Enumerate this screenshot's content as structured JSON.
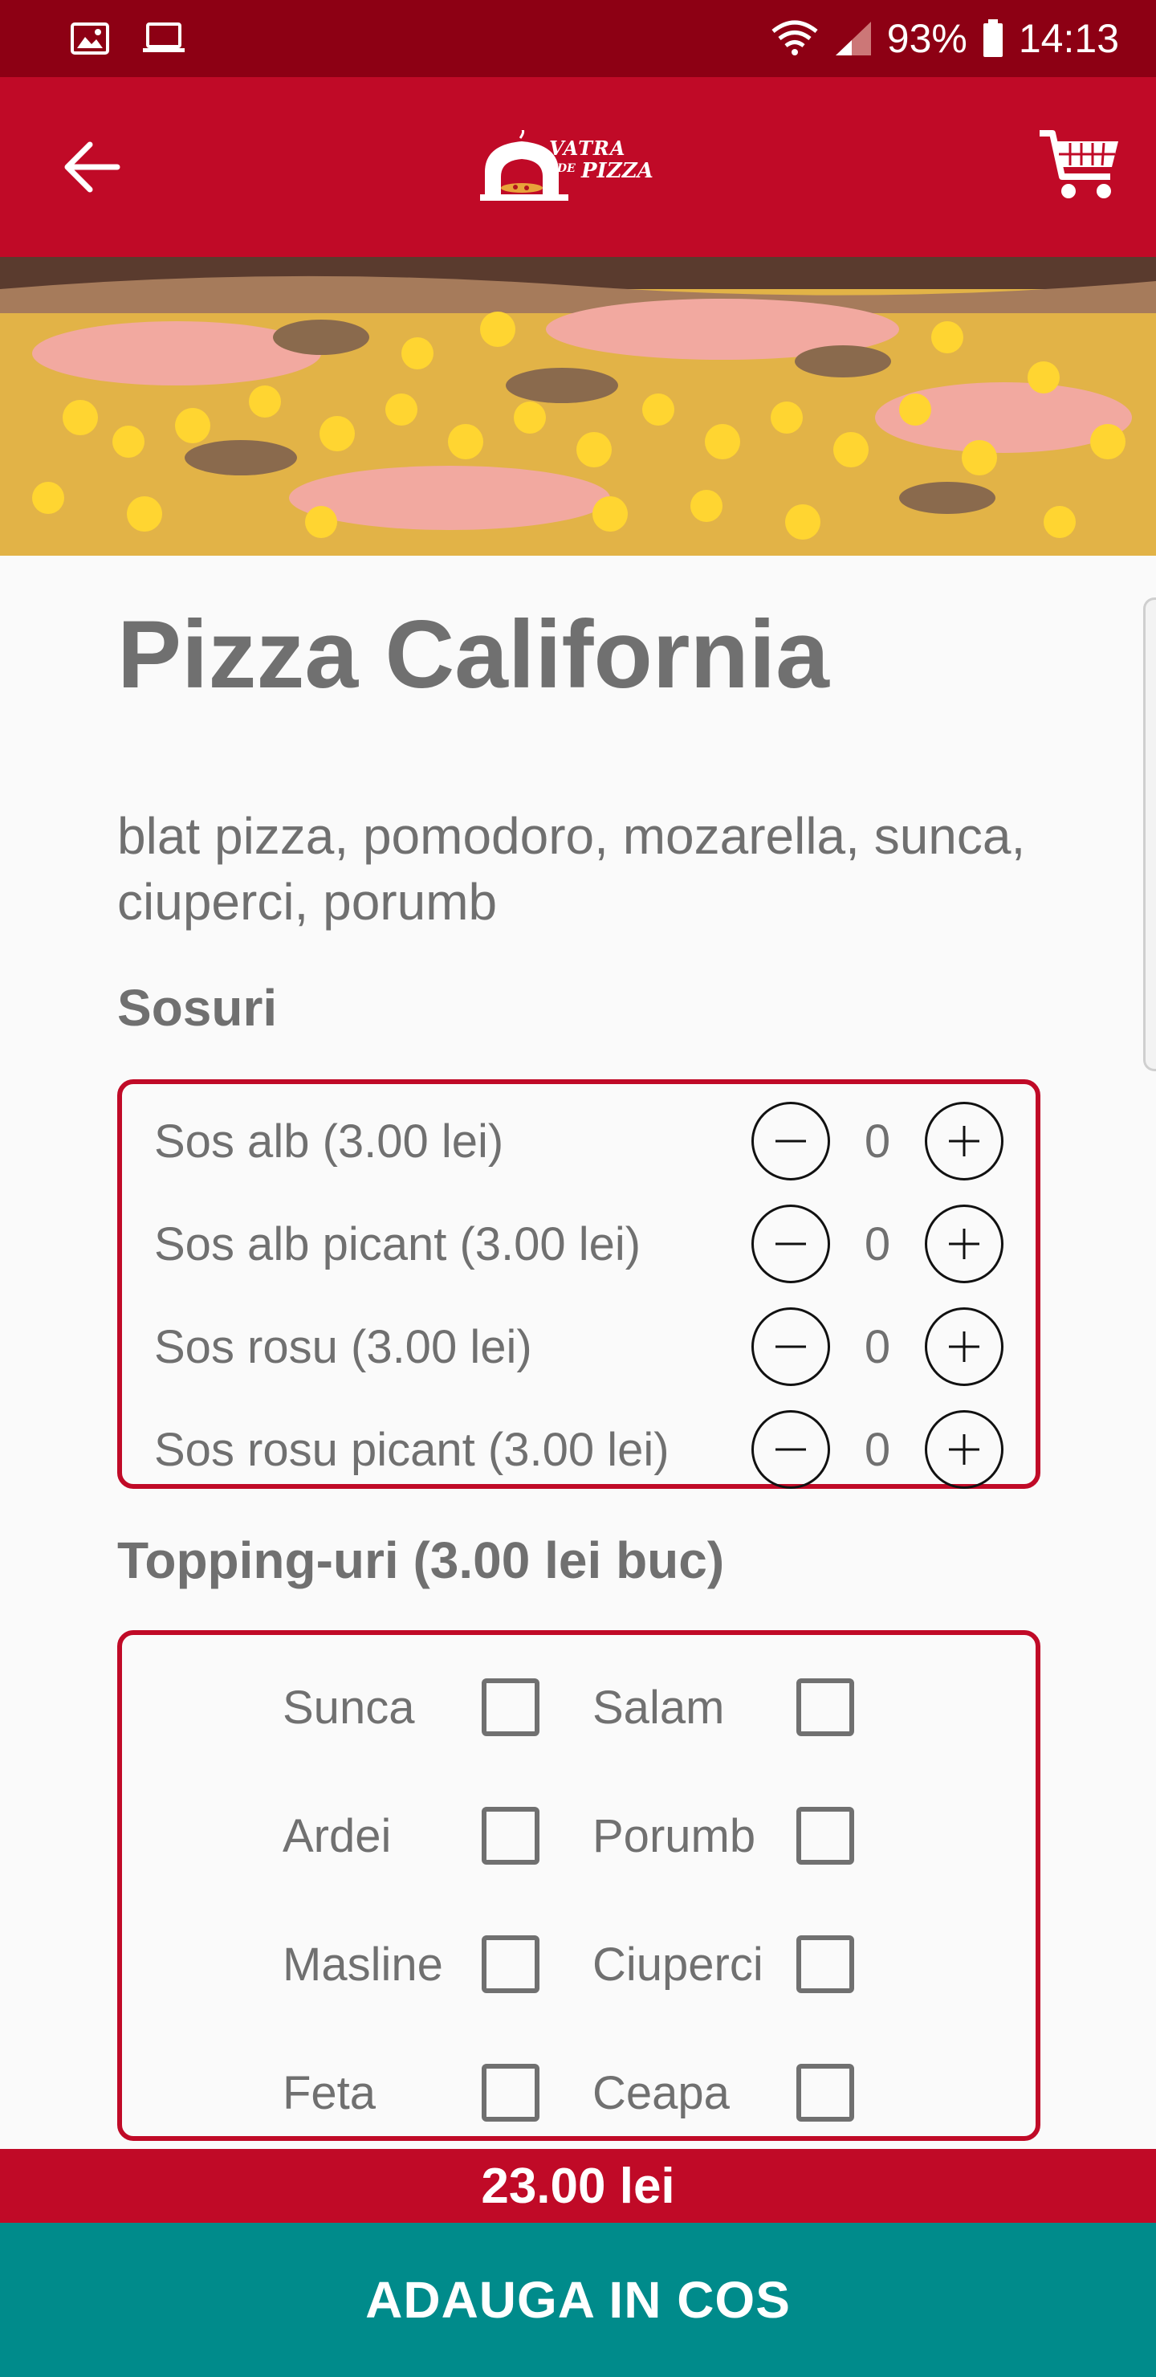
{
  "status_bar": {
    "battery": "93%",
    "time": "14:13"
  },
  "app_bar": {
    "logo_line1": "VATRA",
    "logo_line2": "DE",
    "logo_line3": "PIZZA"
  },
  "product": {
    "title": "Pizza California",
    "description": "blat pizza, pomodoro, mozarella, sunca, ciuperci, porumb"
  },
  "sauces": {
    "heading": "Sosuri",
    "items": [
      {
        "label": "Sos alb (3.00 lei)",
        "qty": "0"
      },
      {
        "label": "Sos alb picant (3.00 lei)",
        "qty": "0"
      },
      {
        "label": "Sos rosu (3.00 lei)",
        "qty": "0"
      },
      {
        "label": "Sos rosu picant (3.00 lei)",
        "qty": "0"
      }
    ]
  },
  "toppings": {
    "heading": "Topping-uri (3.00 lei buc)",
    "items": [
      {
        "label": "Sunca",
        "checked": false
      },
      {
        "label": "Salam",
        "checked": false
      },
      {
        "label": "Ardei",
        "checked": false
      },
      {
        "label": "Porumb",
        "checked": false
      },
      {
        "label": "Masline",
        "checked": false
      },
      {
        "label": "Ciuperci",
        "checked": false
      },
      {
        "label": "Feta",
        "checked": false
      },
      {
        "label": "Ceapa",
        "checked": false
      }
    ]
  },
  "footer": {
    "price": "23.00 lei",
    "add_to_cart": "ADAUGA IN COS"
  },
  "colors": {
    "status_bar": "#8d0014",
    "primary": "#c00a27",
    "accent": "#008b8b",
    "text": "#707070"
  }
}
